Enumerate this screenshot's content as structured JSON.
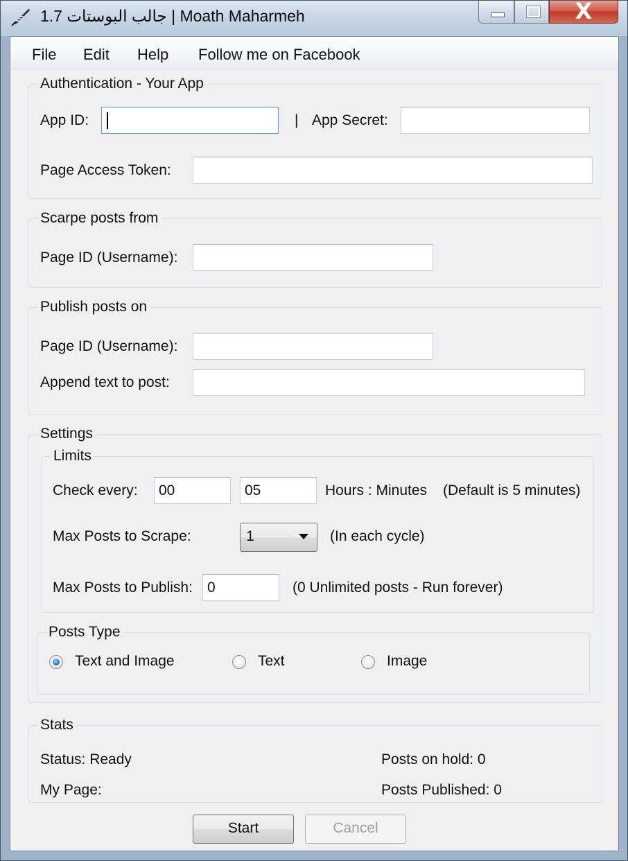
{
  "window": {
    "title": "جالب البوستات 1.7 | Moath Maharmeh",
    "app_icon": "feather-icon",
    "minimize_icon": "minimize-icon",
    "maximize_icon": "maximize-icon",
    "close_icon": "close-icon",
    "close_glyph": "X"
  },
  "menu": {
    "items": [
      "File",
      "Edit",
      "Help",
      "Follow me on Facebook"
    ]
  },
  "authentication": {
    "legend": "Authentication - Your App",
    "app_id_label": "App ID:",
    "app_id_value": "",
    "separator": "|",
    "app_secret_label": "App Secret:",
    "app_secret_value": "",
    "token_label": "Page Access Token:",
    "token_value": ""
  },
  "scrape": {
    "legend": "Scarpe posts from",
    "page_id_label": "Page ID (Username):",
    "page_id_value": ""
  },
  "publish": {
    "legend": "Publish posts on",
    "page_id_label": "Page ID (Username):",
    "page_id_value": "",
    "append_label": "Append text to post:",
    "append_value": ""
  },
  "settings": {
    "legend": "Settings",
    "limits": {
      "legend": "Limits",
      "check_every_label": "Check every:",
      "hours_value": "00",
      "minutes_value": "05",
      "hours_minutes_label": "Hours : Minutes",
      "default_note": "(Default is 5 minutes)",
      "max_scrape_label": "Max Posts to Scrape:",
      "max_scrape_value": "1",
      "max_scrape_note": "(In each cycle)",
      "max_publish_label": "Max Posts to Publish:",
      "max_publish_value": "0",
      "max_publish_note": "(0 Unlimited posts - Run forever)"
    },
    "posts_type": {
      "legend": "Posts Type",
      "options": [
        "Text and Image",
        "Text",
        "Image"
      ],
      "selected": "Text and Image"
    }
  },
  "stats": {
    "legend": "Stats",
    "status": "Status: Ready",
    "my_page": "My Page:",
    "posts_on_hold": "Posts on hold: 0",
    "posts_published": "Posts Published: 0"
  },
  "buttons": {
    "start": "Start",
    "cancel": "Cancel"
  }
}
